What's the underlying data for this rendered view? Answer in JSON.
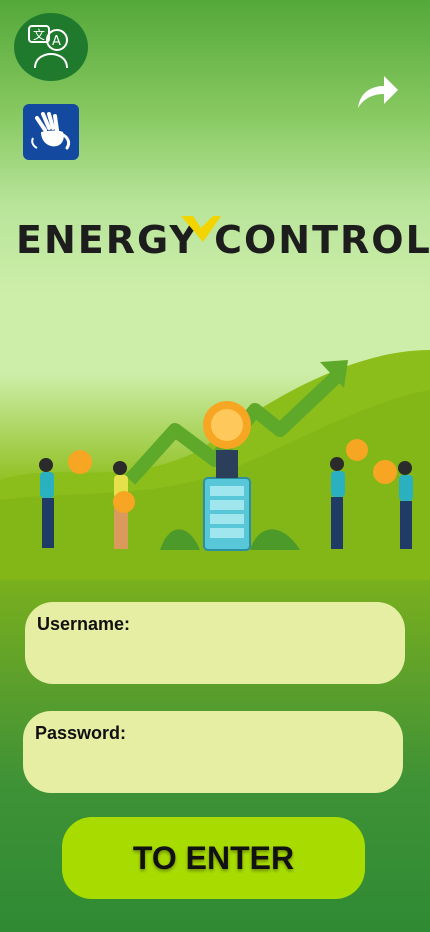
{
  "brand": {
    "part1": "ENERGY",
    "part2": "CONTROL"
  },
  "icons": {
    "translate": "translate-icon",
    "sign_language": "sign-language-icon",
    "share": "share-icon"
  },
  "form": {
    "username_label": "Username:",
    "password_label": "Password:",
    "submit_label": "TO ENTER"
  },
  "colors": {
    "accent": "#a8dc00",
    "dark_green": "#1f7a2e",
    "field_bg": "#e6eea4"
  }
}
